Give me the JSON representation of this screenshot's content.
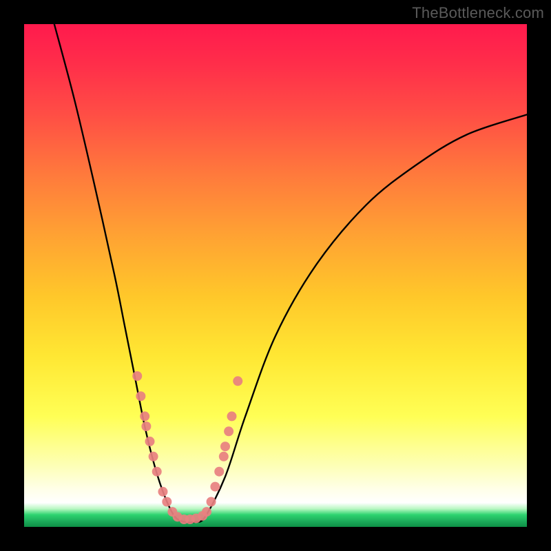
{
  "watermark": "TheBottleneck.com",
  "chart_data": {
    "type": "line",
    "title": "",
    "xlabel": "",
    "ylabel": "",
    "xlim": [
      0,
      100
    ],
    "ylim": [
      0,
      100
    ],
    "curve": {
      "left": [
        {
          "x": 6,
          "y": 100
        },
        {
          "x": 10,
          "y": 85
        },
        {
          "x": 14,
          "y": 68
        },
        {
          "x": 18,
          "y": 50
        },
        {
          "x": 20,
          "y": 40
        },
        {
          "x": 22,
          "y": 30
        },
        {
          "x": 24,
          "y": 20
        },
        {
          "x": 26,
          "y": 12
        },
        {
          "x": 28,
          "y": 6
        },
        {
          "x": 30,
          "y": 2
        }
      ],
      "bottom": [
        {
          "x": 30,
          "y": 2
        },
        {
          "x": 32,
          "y": 1
        },
        {
          "x": 34,
          "y": 1
        },
        {
          "x": 36,
          "y": 2
        }
      ],
      "right": [
        {
          "x": 36,
          "y": 2
        },
        {
          "x": 40,
          "y": 10
        },
        {
          "x": 44,
          "y": 22
        },
        {
          "x": 50,
          "y": 38
        },
        {
          "x": 58,
          "y": 52
        },
        {
          "x": 68,
          "y": 64
        },
        {
          "x": 78,
          "y": 72
        },
        {
          "x": 88,
          "y": 78
        },
        {
          "x": 100,
          "y": 82
        }
      ]
    },
    "markers": [
      {
        "x": 22.5,
        "y": 30
      },
      {
        "x": 23.2,
        "y": 26
      },
      {
        "x": 24.0,
        "y": 22
      },
      {
        "x": 24.3,
        "y": 20
      },
      {
        "x": 25.0,
        "y": 17
      },
      {
        "x": 25.7,
        "y": 14
      },
      {
        "x": 26.4,
        "y": 11
      },
      {
        "x": 27.6,
        "y": 7
      },
      {
        "x": 28.4,
        "y": 5
      },
      {
        "x": 29.5,
        "y": 3
      },
      {
        "x": 30.5,
        "y": 2
      },
      {
        "x": 31.8,
        "y": 1.5
      },
      {
        "x": 33.0,
        "y": 1.5
      },
      {
        "x": 34.2,
        "y": 1.7
      },
      {
        "x": 35.5,
        "y": 2.2
      },
      {
        "x": 36.3,
        "y": 3
      },
      {
        "x": 37.2,
        "y": 5
      },
      {
        "x": 38.0,
        "y": 8
      },
      {
        "x": 38.8,
        "y": 11
      },
      {
        "x": 39.7,
        "y": 14
      },
      {
        "x": 40.0,
        "y": 16
      },
      {
        "x": 40.7,
        "y": 19
      },
      {
        "x": 41.3,
        "y": 22
      },
      {
        "x": 42.5,
        "y": 29
      }
    ],
    "marker_color": "#e88080",
    "marker_radius": 7
  }
}
